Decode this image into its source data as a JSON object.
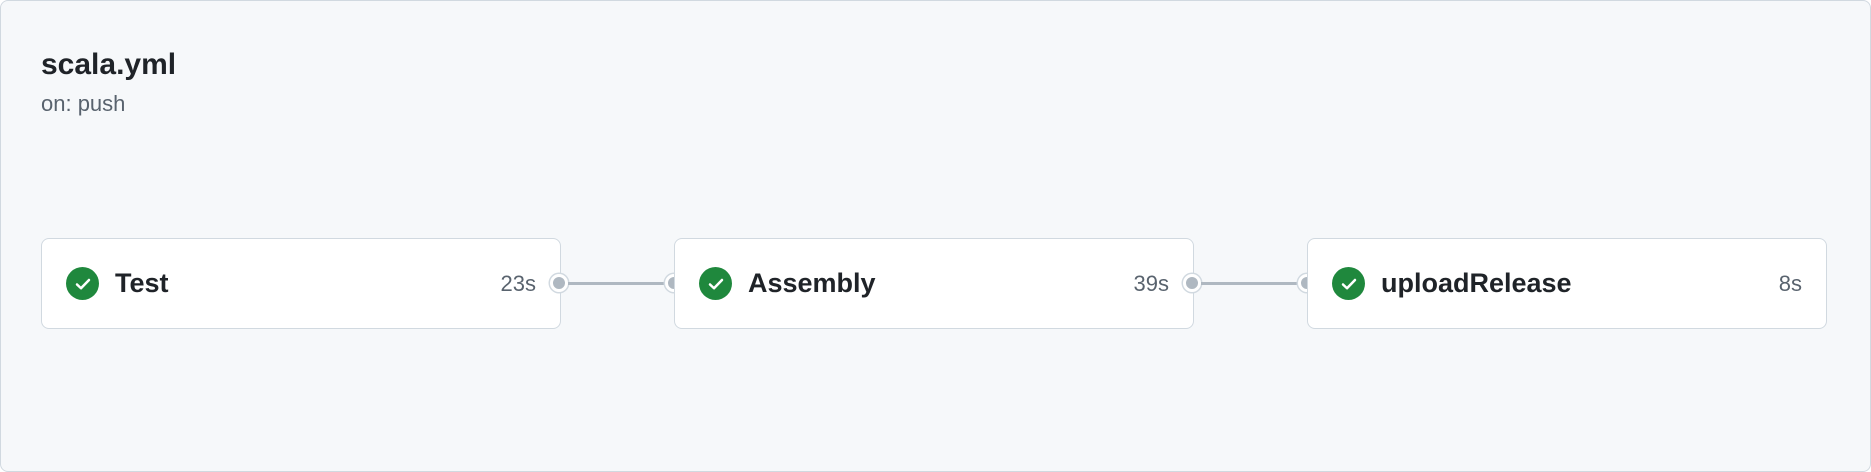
{
  "workflow": {
    "title": "scala.yml",
    "trigger": "on: push"
  },
  "jobs": [
    {
      "name": "Test",
      "duration": "23s",
      "status": "success",
      "status_icon": "check-circle-fill-icon"
    },
    {
      "name": "Assembly",
      "duration": "39s",
      "status": "success",
      "status_icon": "check-circle-fill-icon"
    },
    {
      "name": "uploadRelease",
      "duration": "8s",
      "status": "success",
      "status_icon": "check-circle-fill-icon"
    }
  ],
  "colors": {
    "success": "#1f883d",
    "panel_bg": "#f6f8fa",
    "border": "#d1d9e0",
    "connector": "#afb8c1"
  }
}
